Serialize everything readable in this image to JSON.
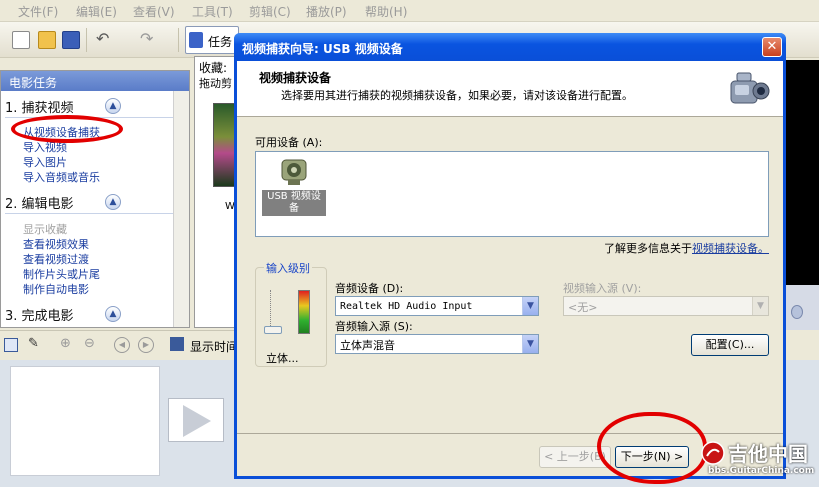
{
  "menu": {
    "items": [
      "文件(F)",
      "编辑(E)",
      "查看(V)",
      "工具(T)",
      "剪辑(C)",
      "播放(P)",
      "帮助(H)"
    ]
  },
  "toolbar": {
    "task_label": "任务"
  },
  "task_pane": {
    "header": "电影任务",
    "sections": [
      {
        "title": "1. 捕获视频",
        "links": [
          "从视频设备捕获",
          "导入视频",
          "导入图片",
          "导入音频或音乐"
        ]
      },
      {
        "title": "2. 编辑电影",
        "links": [
          "显示收藏",
          "查看视频效果",
          "查看视频过渡",
          "制作片头或片尾",
          "制作自动电影"
        ]
      },
      {
        "title": "3. 完成电影",
        "links": []
      }
    ]
  },
  "collection": {
    "title": "收藏:",
    "subtitle": "拖动剪",
    "clip_label": "Wa"
  },
  "timeline": {
    "show_time_label": "显示时间"
  },
  "dialog": {
    "title": "视频捕获向导: USB 视频设备",
    "heading": "视频捕获设备",
    "subheading": "选择要用其进行捕获的视频捕获设备，如果必要，请对该设备进行配置。",
    "available_label": "可用设备 (A):",
    "device_name": "USB 视频设备",
    "learn_more_prefix": "了解更多信息关于",
    "learn_more_link": "视频捕获设备。",
    "input_level_title": "输入级别",
    "input_level_value": "立体...",
    "audio_device_label": "音频设备 (D):",
    "audio_device_value": "Realtek HD Audio Input",
    "audio_source_label": "音频输入源 (S):",
    "audio_source_value": "立体声混音",
    "video_source_label": "视频输入源 (V):",
    "video_source_value": "<无>",
    "configure_button": "配置(C)...",
    "back_button": "< 上一步(B)",
    "next_button": "下一步(N) >"
  },
  "watermark": {
    "brand": "吉他中国",
    "url": "bbs.GuitarChina.com"
  },
  "colors": {
    "title_bar": "#0a54e0",
    "annotation": "#e20000",
    "link": "#1a3da0"
  }
}
